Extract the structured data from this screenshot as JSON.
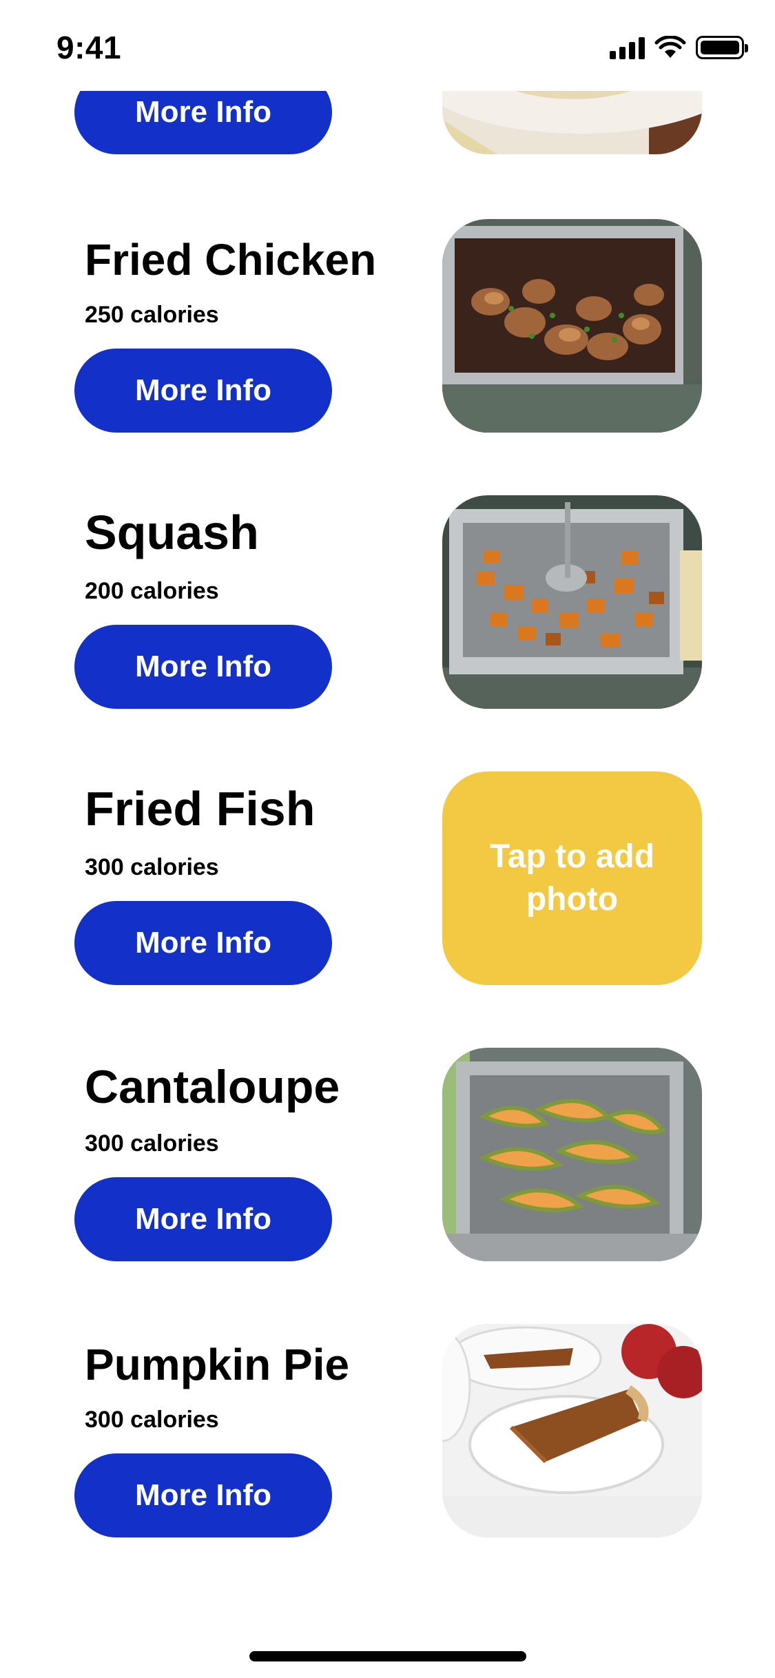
{
  "status_bar": {
    "time": "9:41"
  },
  "partial_item": {
    "more_info_label": "More Info"
  },
  "items": [
    {
      "name": "Fried Chicken",
      "calories": "250 calories",
      "more_info_label": "More Info"
    },
    {
      "name": "Squash",
      "calories": "200 calories",
      "more_info_label": "More Info"
    },
    {
      "name": "Fried Fish",
      "calories": "300 calories",
      "more_info_label": "More Info",
      "photo_placeholder": "Tap to add photo"
    },
    {
      "name": "Cantaloupe",
      "calories": "300 calories",
      "more_info_label": "More Info"
    },
    {
      "name": "Pumpkin Pie",
      "calories": "300 calories",
      "more_info_label": "More Info"
    }
  ],
  "colors": {
    "button": "#1330c8",
    "placeholder": "#f3c843"
  }
}
